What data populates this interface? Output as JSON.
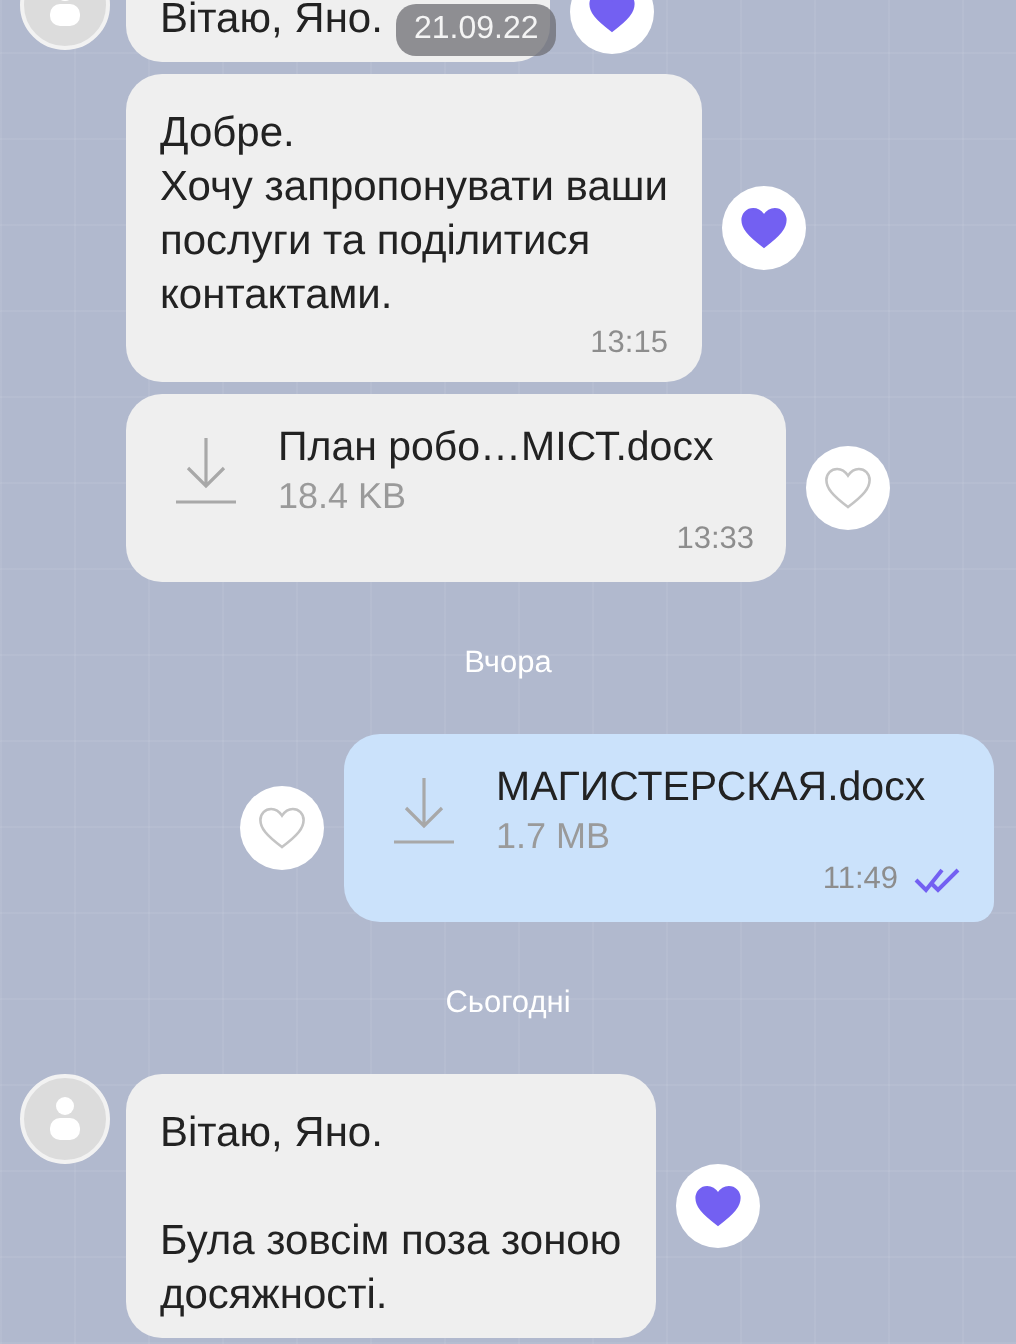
{
  "date_badge": "21.09.22",
  "items": [
    {
      "kind": "text",
      "outgoing": false,
      "avatar": true,
      "liked": true,
      "text": "Вітаю, Яно."
    },
    {
      "kind": "text",
      "outgoing": false,
      "avatar": false,
      "liked": true,
      "text": "Добре.\nХочу запропонувати ваши\nпослуги та поділитися\nконтактами.",
      "time": "13:15"
    },
    {
      "kind": "file",
      "outgoing": false,
      "avatar": false,
      "liked": false,
      "file_name": "План робо…МІСТ.docx",
      "size": "18.4 KB",
      "time": "13:33"
    },
    {
      "kind": "separator",
      "label": "Вчора"
    },
    {
      "kind": "file",
      "outgoing": true,
      "liked": false,
      "file_name": "МАГИСТЕРСКАЯ.docx",
      "size": "1.7 MB",
      "time": "11:49",
      "read": true
    },
    {
      "kind": "separator",
      "label": "Сьогодні"
    },
    {
      "kind": "text",
      "outgoing": false,
      "avatar": true,
      "liked": true,
      "text": "Вітаю, Яно.\n\nБула зовсім поза зоною\nдосяжності."
    }
  ]
}
